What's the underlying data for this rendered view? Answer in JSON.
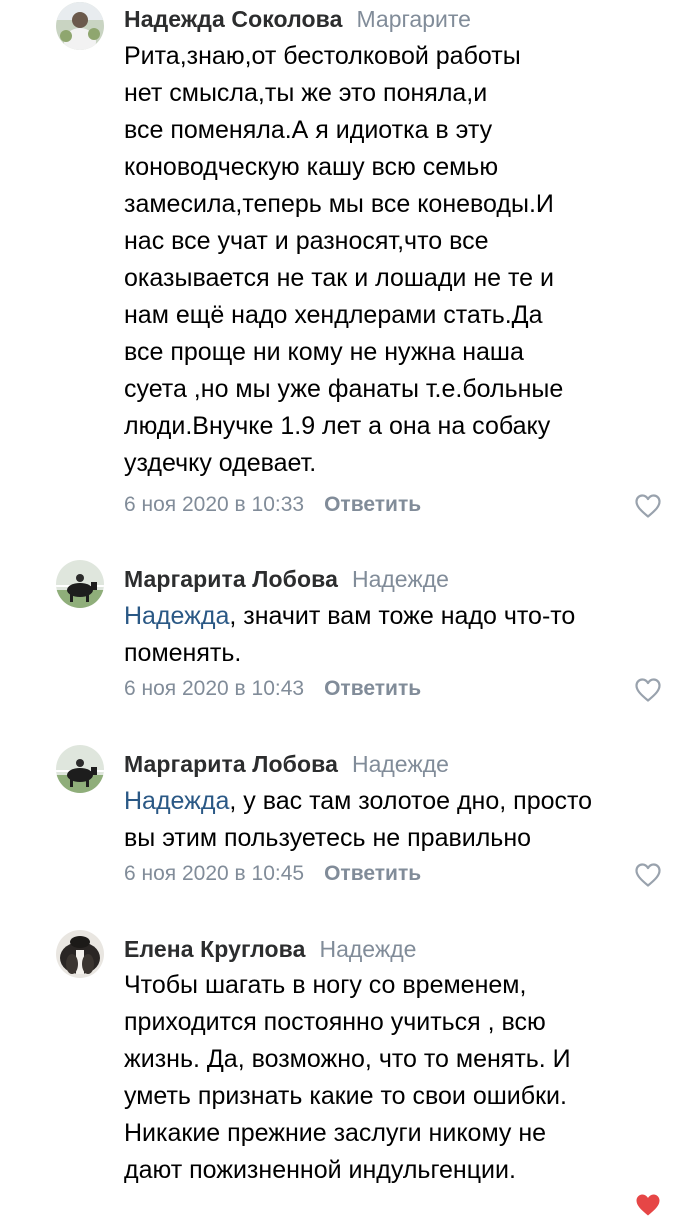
{
  "colors": {
    "author": "#2c2d2e",
    "muted": "#818c99",
    "link": "#2a5885",
    "text": "#000000",
    "like_active": "#e64646"
  },
  "comments": [
    {
      "author": "Надежда Соколова",
      "reply_to": "Маргарите",
      "mention": "",
      "text": "Рита,знаю,от бестолковой работы\nнет смысла,ты же это поняла,и\nвсе поменяла.А я идиотка в эту\nконоводческую кашу всю семью\nзамесила,теперь мы все коневоды.И\nнас все учат и разносят,что все\nоказывается не так и лошади не те и\nнам ещё надо хендлерами стать.Да\nвсе проще ни кому не нужна наша\nсуета ,но мы уже фанаты т.е.больные\nлюди.Внучке 1.9 лет а она на собаку\nуздечку одевает.",
      "date": "6 ноя 2020 в 10:33",
      "reply_label": "Ответить",
      "like_icon": "heart-outline-icon"
    },
    {
      "author": "Маргарита Лобова",
      "reply_to": "Надежде",
      "mention": "Надежда",
      "text": ", значит вам тоже надо что-то\nпоменять.",
      "date": "6 ноя 2020 в 10:43",
      "reply_label": "Ответить",
      "like_icon": "heart-outline-icon"
    },
    {
      "author": "Маргарита Лобова",
      "reply_to": "Надежде",
      "mention": "Надежда",
      "text": ", у вас там золотое дно, просто\nвы этим пользуетесь не правильно",
      "date": "6 ноя 2020 в 10:45",
      "reply_label": "Ответить",
      "like_icon": "heart-outline-icon"
    },
    {
      "author": "Елена Круглова",
      "reply_to": "Надежде",
      "mention": "",
      "text": "Чтобы шагать в ногу со временем,\nприходится постоянно учиться , всю\nжизнь. Да, возможно, что то менять. И\nуметь признать какие то свои ошибки.\nНикакие прежние заслуги никому не\nдают пожизненной индульгенции.",
      "date": "",
      "reply_label": "",
      "like_icon": "heart-filled-icon"
    }
  ]
}
